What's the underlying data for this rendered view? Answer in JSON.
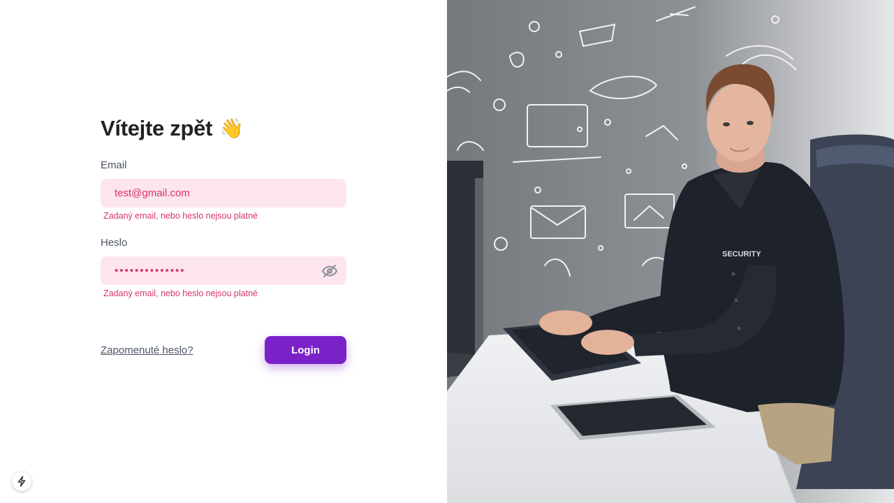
{
  "login": {
    "title": "Vítejte zpět",
    "wave_emoji": "👋",
    "email": {
      "label": "Email",
      "value": "test@gmail.com",
      "error": "Zadaný email, nebo heslo nejsou platné"
    },
    "password": {
      "label": "Heslo",
      "value": "••••••••••••••",
      "toggle_icon": "eye-off-icon",
      "error": "Zadaný email, nebo heslo nejsou platné"
    },
    "forgot_link": "Zapomenuté heslo?",
    "login_button": "Login"
  },
  "hero_image": {
    "badge_text": "SECURITY"
  },
  "dev_indicator": {
    "icon": "lightning-icon"
  },
  "colors": {
    "accent": "#7a22c8",
    "input_bg": "#fde5ee",
    "error": "#d6336c",
    "wall": "#7c7f83"
  }
}
